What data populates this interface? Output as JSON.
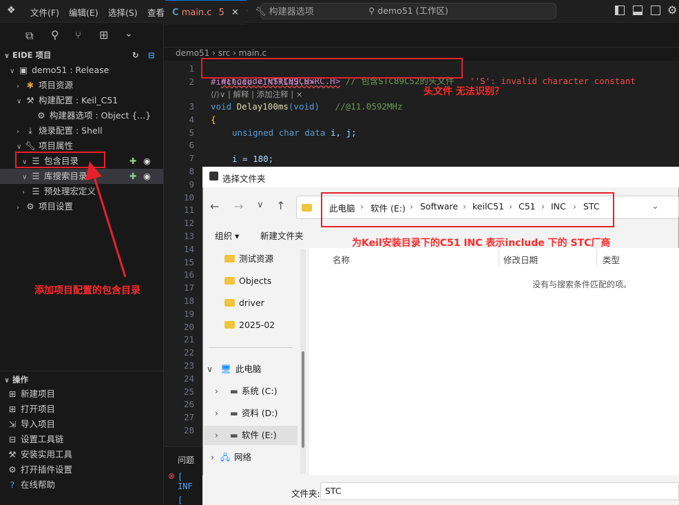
{
  "titlebar": {
    "menus": [
      "文件(F)",
      "编辑(E)",
      "选择(S)",
      "查看(V)",
      "···"
    ],
    "search_text": "demo51 (工作区)"
  },
  "sidebar": {
    "section_title": "EIDE 项目",
    "project": "demo51 : Release",
    "items": [
      {
        "label": "项目资源",
        "icon": "resource-icon"
      },
      {
        "label": "构建配置 : Keil_C51",
        "icon": "hammer-icon"
      },
      {
        "label": "构建器选项 : Object {...}",
        "icon": "options-icon"
      },
      {
        "label": "烧录配置 : Shell",
        "icon": "flash-icon"
      },
      {
        "label": "项目属性",
        "icon": "wrench-icon"
      },
      {
        "label": "包含目录",
        "icon": "list-icon"
      },
      {
        "label": "库搜索目录",
        "icon": "list-icon"
      },
      {
        "label": "预处理宏定义",
        "icon": "list-icon"
      },
      {
        "label": "项目设置",
        "icon": "gear-icon"
      }
    ],
    "ops_title": "操作",
    "ops": [
      "新建项目",
      "打开项目",
      "导入项目",
      "设置工具链",
      "安装实用工具",
      "打开插件设置",
      "在线帮助"
    ]
  },
  "tabs": [
    {
      "label": "main.c",
      "badge": "5",
      "icon": "c-file-icon"
    },
    {
      "label": "构建器选项",
      "icon": "wrench-icon"
    }
  ],
  "breadcrumb": "demo51 › src › main.c",
  "editor": {
    "line1": "#include <STC89C5xRC.H>",
    "line1_comment": "// 包含STC89C52的头文件",
    "line1_error": "''S': invalid character constant",
    "line2": "#include <INTRINS.H>",
    "codelens": "⟨/⟩∨ | 解释 | 添加注释 | ×",
    "line3_a": "void",
    "line3_b": "Delay100ms",
    "line3_c": "(void)",
    "line3_comment": "//@11.0592MHz",
    "line4": "{",
    "line5_a": "unsigned char data",
    "line5_b": "i, j;",
    "line7": "i = 180;",
    "line_numbers": [
      "1",
      "2",
      "3",
      "4",
      "5",
      "6",
      "7",
      "8",
      "9",
      "10",
      "11",
      "12",
      "13",
      "14",
      "15",
      "16",
      "17",
      "18",
      "19",
      "20",
      "21",
      "22",
      "23",
      "24",
      "25",
      "26",
      "27",
      "28"
    ]
  },
  "panel": {
    "tab": "问题",
    "line1": "[ INF",
    "line2": "[ TOO"
  },
  "dialog": {
    "title": "选择文件夹",
    "crumbs": [
      "此电脑",
      "软件 (E:)",
      "Software",
      "keilC51",
      "C51",
      "INC",
      "STC"
    ],
    "organize": "组织 ▾",
    "new_folder": "新建文件夹",
    "nav_folders": [
      "测试资源",
      "Objects",
      "driver",
      "2025-02"
    ],
    "nav_pc": "此电脑",
    "drives": [
      "系统 (C:)",
      "资料 (D:)",
      "软件 (E:)"
    ],
    "network": "网络",
    "columns": [
      "名称",
      "修改日期",
      "类型"
    ],
    "empty_message": "没有与搜索条件匹配的项。",
    "folder_label": "文件夹:",
    "folder_value": "STC"
  },
  "annotations": {
    "header_issue": "头文件 无法识别？",
    "include_dir": "添加项目配置的包含目录",
    "keil_note": "为Keil安装目录下的C51  INC 表示include  下的   STC厂商"
  },
  "colors": {
    "accent_red": "#e8202a",
    "editor_bg": "#1f1f1f",
    "dialog_bg": "#f3f3f3"
  }
}
